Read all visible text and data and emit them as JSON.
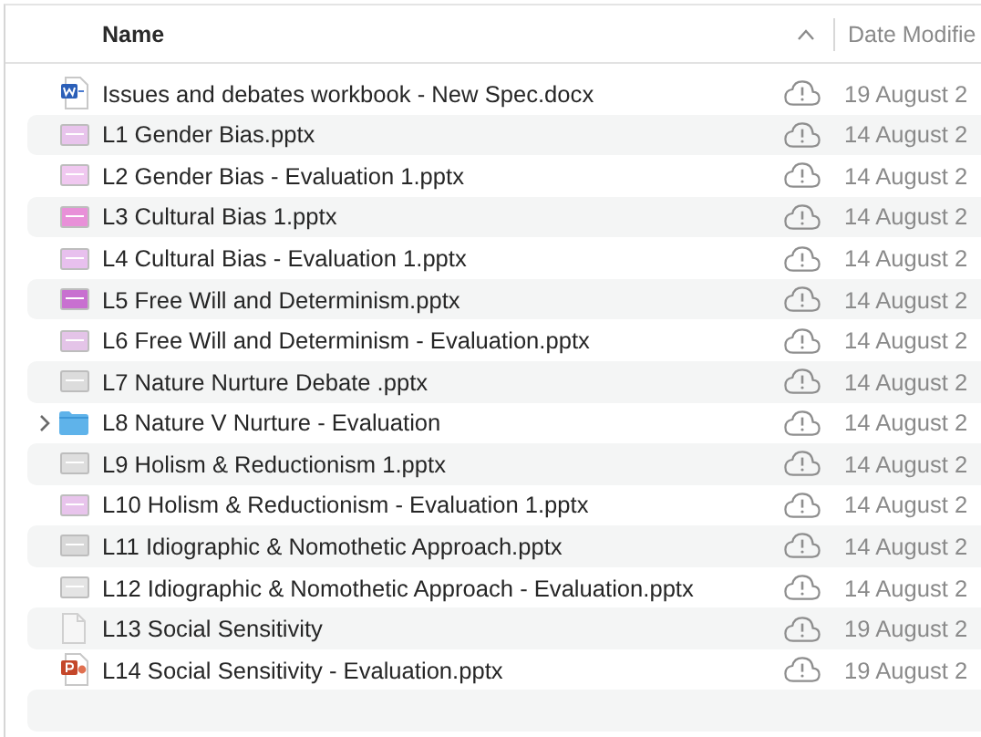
{
  "header": {
    "name_label": "Name",
    "sort_ascending": true,
    "date_label": "Date Modifie"
  },
  "files": [
    {
      "name": "Issues and debates workbook - New Spec.docx",
      "kind": "word",
      "date": "19 August 2"
    },
    {
      "name": "L1 Gender Bias.pptx",
      "kind": "slides",
      "color": "#e8c4ec",
      "date": "14 August 2"
    },
    {
      "name": "L2 Gender Bias - Evaluation 1.pptx",
      "kind": "slides",
      "color": "#f0c8f0",
      "date": "14 August 2"
    },
    {
      "name": "L3 Cultural Bias 1.pptx",
      "kind": "slides",
      "color": "#e890d8",
      "date": "14 August 2"
    },
    {
      "name": "L4 Cultural Bias - Evaluation 1.pptx",
      "kind": "slides",
      "color": "#e8c0ee",
      "date": "14 August 2"
    },
    {
      "name": "L5 Free Will and Determinism.pptx",
      "kind": "slides",
      "color": "#c870d0",
      "date": "14 August 2"
    },
    {
      "name": "L6 Free Will and Determinism - Evaluation.pptx",
      "kind": "slides",
      "color": "#e4c4e8",
      "date": "14 August 2"
    },
    {
      "name": "L7 Nature Nurture Debate .pptx",
      "kind": "slides",
      "color": "#dcdcdc",
      "date": "14 August 2"
    },
    {
      "name": "L8 Nature V Nurture - Evaluation",
      "kind": "folder",
      "expanded": false,
      "date": "14 August 2"
    },
    {
      "name": "L9 Holism & Reductionism 1.pptx",
      "kind": "slides",
      "color": "#dedede",
      "date": "14 August 2"
    },
    {
      "name": "L10 Holism & Reductionism - Evaluation 1.pptx",
      "kind": "slides",
      "color": "#e8c4ec",
      "date": "14 August 2"
    },
    {
      "name": "L11 Idiographic & Nomothetic Approach.pptx",
      "kind": "slides",
      "color": "#d8d8d8",
      "date": "14 August 2"
    },
    {
      "name": "L12 Idiographic & Nomothetic Approach - Evaluation.pptx",
      "kind": "slides",
      "color": "#e4e4e4",
      "date": "14 August 2"
    },
    {
      "name": "L13 Social Sensitivity",
      "kind": "document",
      "date": "19 August 2"
    },
    {
      "name": "L14 Social Sensitivity - Evaluation.pptx",
      "kind": "powerpoint",
      "date": "19 August 2"
    }
  ]
}
